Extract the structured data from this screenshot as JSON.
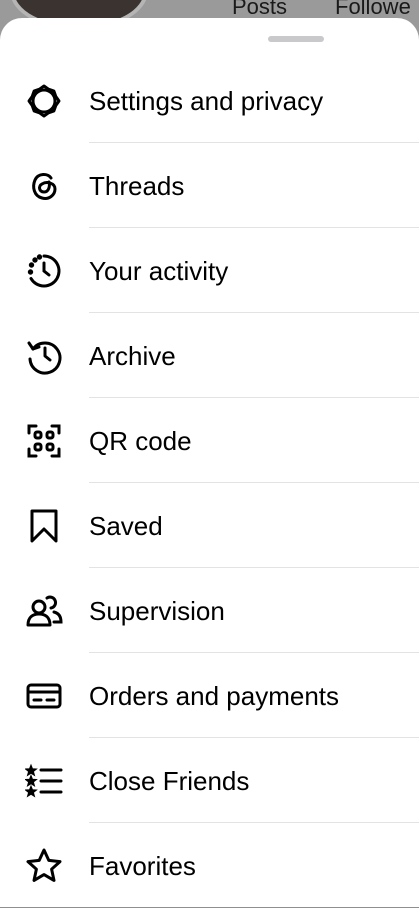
{
  "profile_backdrop": {
    "posts_label": "Posts",
    "followers_label": "Followe"
  },
  "menu": {
    "items": [
      {
        "label": "Settings and privacy",
        "icon": "settings-gear-icon"
      },
      {
        "label": "Threads",
        "icon": "threads-icon"
      },
      {
        "label": "Your activity",
        "icon": "activity-clock-icon"
      },
      {
        "label": "Archive",
        "icon": "archive-history-icon"
      },
      {
        "label": "QR code",
        "icon": "qr-code-icon"
      },
      {
        "label": "Saved",
        "icon": "bookmark-icon"
      },
      {
        "label": "Supervision",
        "icon": "supervision-people-icon"
      },
      {
        "label": "Orders and payments",
        "icon": "credit-card-icon"
      },
      {
        "label": "Close Friends",
        "icon": "close-friends-list-icon"
      },
      {
        "label": "Favorites",
        "icon": "star-icon"
      }
    ]
  }
}
